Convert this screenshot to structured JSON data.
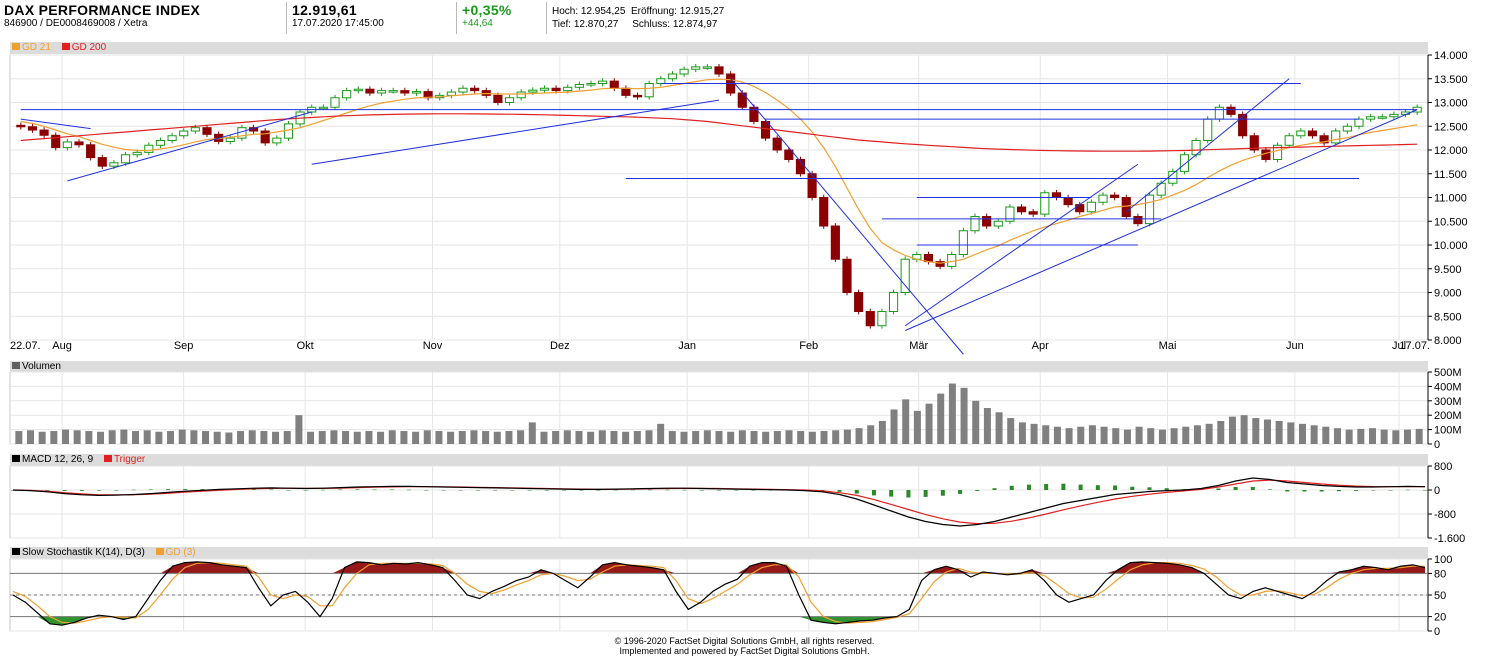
{
  "header": {
    "title": "DAX PERFORMANCE INDEX",
    "subtitle": "846900 / DE0008469008 / Xetra",
    "price": "12.919,61",
    "datetime": "17.07.2020 17:45:00",
    "change_pct": "+0,35%",
    "change_abs": "+44,64",
    "high_label": "Hoch:",
    "high": "12.954,25",
    "open_label": "Eröffnung:",
    "open": "12.915,27",
    "low_label": "Tief:",
    "low": "12.870,27",
    "close_label": "Schluss:",
    "close": "12.874,97"
  },
  "colors": {
    "up": "#1a9a1a",
    "down": "#8b0000",
    "gd21": "#f0a030",
    "gd200": "#e02020",
    "trend": "#2030e0",
    "volume": "#808080",
    "macd": "#000000",
    "trigger": "#e02020",
    "hist": "#2a8a2a"
  },
  "legend": {
    "price": [
      {
        "label": "GD 21",
        "color": "#f0a030"
      },
      {
        "label": "GD 200",
        "color": "#e02020"
      }
    ],
    "volume": [
      {
        "label": "Volumen",
        "color": "#606060"
      }
    ],
    "macd": [
      {
        "label": "MACD 12, 26, 9",
        "color": "#000000"
      },
      {
        "label": "Trigger",
        "color": "#e02020"
      }
    ],
    "stoch": [
      {
        "label": "Slow Stochastik K(14), D(3)",
        "color": "#000000"
      },
      {
        "label": "GD (3)",
        "color": "#f0a030"
      }
    ]
  },
  "footer": {
    "line1": "© 1996-2020 FactSet Digital Solutions GmbH, all rights reserved.",
    "line2": "Implemented and powered by FactSet Digital Solutions GmbH."
  },
  "chart_data": [
    {
      "type": "line",
      "name": "price",
      "x_labels": [
        "22.07.",
        "Aug",
        "Sep",
        "Okt",
        "Nov",
        "Dez",
        "Jan",
        "Feb",
        "Mär",
        "Apr",
        "Mai",
        "Jun",
        "Jul",
        "17.07."
      ],
      "x_positions": [
        0,
        9,
        30,
        51,
        73,
        95,
        117,
        138,
        157,
        178,
        200,
        222,
        240,
        244
      ],
      "ylim": [
        8000,
        14000
      ],
      "yticks": [
        "14.000",
        "13.500",
        "13.000",
        "12.500",
        "12.000",
        "11.500",
        "11.000",
        "10.500",
        "10.000",
        "9.500",
        "9.000",
        "8.500",
        "8.000"
      ],
      "ytick_values": [
        14000,
        13500,
        13000,
        12500,
        12000,
        11500,
        11000,
        10500,
        10000,
        9500,
        9000,
        8500,
        8000
      ],
      "close": [
        12490,
        12420,
        12310,
        12050,
        12170,
        12110,
        11840,
        11660,
        11730,
        11900,
        11950,
        12100,
        12200,
        12300,
        12400,
        12470,
        12330,
        12180,
        12250,
        12470,
        12400,
        12150,
        12250,
        12550,
        12800,
        12900,
        12900,
        13100,
        13250,
        13280,
        13200,
        13250,
        13250,
        13200,
        13230,
        13100,
        13150,
        13220,
        13300,
        13250,
        13150,
        13000,
        13100,
        13220,
        13260,
        13300,
        13250,
        13320,
        13380,
        13400,
        13450,
        13300,
        13150,
        13120,
        13400,
        13500,
        13600,
        13700,
        13750,
        13750,
        13600,
        13200,
        12900,
        12600,
        12250,
        12000,
        11800,
        11500,
        11000,
        10400,
        9700,
        9000,
        8600,
        8300,
        8600,
        9000,
        9700,
        9800,
        9650,
        9550,
        9800,
        10300,
        10600,
        10400,
        10500,
        10800,
        10700,
        10650,
        11100,
        11000,
        10850,
        10700,
        10900,
        11050,
        11000,
        10600,
        10450,
        11050,
        11300,
        11550,
        11900,
        12200,
        12650,
        12900,
        12750,
        12300,
        12000,
        11800,
        12100,
        12300,
        12400,
        12300,
        12150,
        12400,
        12500,
        12650,
        12700,
        12700,
        12750,
        12800,
        12900
      ],
      "gd21": [
        12600,
        12560,
        12500,
        12420,
        12340,
        12280,
        12200,
        12120,
        12060,
        12010,
        11990,
        11990,
        12020,
        12060,
        12110,
        12170,
        12220,
        12240,
        12270,
        12300,
        12330,
        12340,
        12380,
        12420,
        12470,
        12540,
        12620,
        12700,
        12780,
        12860,
        12930,
        12990,
        13030,
        13070,
        13100,
        13110,
        13120,
        13140,
        13160,
        13180,
        13190,
        13180,
        13180,
        13180,
        13190,
        13200,
        13210,
        13220,
        13240,
        13260,
        13290,
        13300,
        13300,
        13290,
        13300,
        13320,
        13360,
        13400,
        13440,
        13480,
        13490,
        13480,
        13430,
        13340,
        13210,
        13050,
        12870,
        12650,
        12380,
        12050,
        11650,
        11200,
        10750,
        10350,
        10050,
        9900,
        9780,
        9700,
        9650,
        9620,
        9650,
        9700,
        9800,
        9900,
        9980,
        10100,
        10200,
        10300,
        10380,
        10450,
        10520,
        10600,
        10660,
        10730,
        10800,
        10820,
        10850,
        10900,
        10960,
        11050,
        11150,
        11270,
        11420,
        11560,
        11680,
        11780,
        11860,
        11930,
        11990,
        12050,
        12100,
        12140,
        12170,
        12220,
        12260,
        12320,
        12370,
        12410,
        12450,
        12490,
        12530
      ],
      "gd200": [
        12200,
        12220,
        12240,
        12260,
        12280,
        12300,
        12320,
        12340,
        12360,
        12380,
        12400,
        12420,
        12440,
        12460,
        12480,
        12500,
        12520,
        12540,
        12560,
        12580,
        12600,
        12620,
        12640,
        12655,
        12670,
        12685,
        12700,
        12712,
        12722,
        12730,
        12738,
        12745,
        12750,
        12755,
        12758,
        12760,
        12762,
        12762,
        12762,
        12760,
        12758,
        12756,
        12754,
        12750,
        12746,
        12740,
        12734,
        12728,
        12722,
        12716,
        12710,
        12704,
        12698,
        12690,
        12680,
        12670,
        12660,
        12640,
        12620,
        12600,
        12570,
        12540,
        12510,
        12480,
        12450,
        12420,
        12390,
        12360,
        12330,
        12300,
        12270,
        12240,
        12210,
        12190,
        12170,
        12150,
        12130,
        12115,
        12100,
        12085,
        12070,
        12055,
        12040,
        12028,
        12018,
        12010,
        12002,
        11996,
        11990,
        11985,
        11980,
        11978,
        11976,
        11975,
        11974,
        11974,
        11975,
        11977,
        11980,
        11985,
        11990,
        11998,
        12006,
        12014,
        12022,
        12030,
        12037,
        12044,
        12050,
        12056,
        12062,
        12068,
        12074,
        12080,
        12086,
        12092,
        12098,
        12104,
        12110,
        12116,
        12122
      ]
    },
    {
      "type": "bar",
      "name": "Volumen",
      "ylim": [
        0,
        500
      ],
      "yticks": [
        "500M",
        "400M",
        "300M",
        "200M",
        "100M",
        "0"
      ],
      "ytick_values": [
        500,
        400,
        300,
        200,
        100,
        0
      ],
      "values": [
        90,
        95,
        85,
        90,
        100,
        95,
        90,
        85,
        95,
        100,
        90,
        95,
        85,
        90,
        100,
        95,
        90,
        85,
        80,
        90,
        95,
        90,
        85,
        90,
        200,
        85,
        90,
        95,
        90,
        85,
        90,
        85,
        95,
        90,
        85,
        95,
        90,
        85,
        90,
        95,
        90,
        85,
        90,
        95,
        150,
        85,
        90,
        95,
        90,
        85,
        95,
        90,
        85,
        90,
        95,
        140,
        90,
        85,
        90,
        95,
        90,
        85,
        95,
        90,
        85,
        90,
        95,
        90,
        85,
        90,
        95,
        100,
        110,
        130,
        160,
        240,
        310,
        230,
        280,
        350,
        420,
        390,
        300,
        250,
        220,
        180,
        150,
        140,
        130,
        120,
        110,
        120,
        130,
        120,
        110,
        100,
        120,
        110,
        100,
        110,
        120,
        130,
        140,
        160,
        190,
        200,
        180,
        170,
        160,
        150,
        140,
        130,
        120,
        110,
        100,
        105,
        110,
        100,
        95,
        100,
        105
      ]
    },
    {
      "type": "line",
      "name": "MACD 12, 26, 9",
      "ylim": [
        -1600,
        800
      ],
      "yticks": [
        "800",
        "0",
        "-800",
        "-1.600"
      ],
      "ytick_values": [
        800,
        0,
        -800,
        -1600
      ],
      "macd": [
        0,
        -20,
        -60,
        -120,
        -160,
        -180,
        -170,
        -150,
        -120,
        -80,
        -40,
        -10,
        20,
        40,
        60,
        70,
        60,
        50,
        60,
        80,
        100,
        110,
        120,
        120,
        110,
        100,
        90,
        80,
        70,
        60,
        50,
        40,
        30,
        20,
        20,
        30,
        40,
        50,
        60,
        60,
        50,
        40,
        30,
        20,
        10,
        0,
        -20,
        -60,
        -150,
        -300,
        -500,
        -700,
        -900,
        -1050,
        -1150,
        -1200,
        -1150,
        -1050,
        -900,
        -750,
        -600,
        -450,
        -350,
        -250,
        -150,
        -100,
        -50,
        -20,
        0,
        50,
        150,
        300,
        400,
        350,
        250,
        200,
        150,
        120,
        100,
        100,
        110,
        120,
        110
      ],
      "trigger": [
        0,
        -10,
        -40,
        -90,
        -130,
        -160,
        -165,
        -160,
        -140,
        -110,
        -70,
        -40,
        -10,
        20,
        40,
        55,
        60,
        55,
        55,
        65,
        80,
        95,
        105,
        110,
        110,
        105,
        100,
        90,
        80,
        70,
        60,
        50,
        40,
        30,
        25,
        25,
        30,
        40,
        50,
        55,
        55,
        50,
        40,
        30,
        20,
        10,
        0,
        -30,
        -90,
        -180,
        -320,
        -480,
        -650,
        -820,
        -960,
        -1070,
        -1120,
        -1110,
        -1040,
        -930,
        -800,
        -660,
        -530,
        -410,
        -300,
        -210,
        -140,
        -80,
        -30,
        20,
        100,
        200,
        300,
        330,
        300,
        250,
        200,
        160,
        130,
        115,
        110,
        110,
        110
      ],
      "histogram": [
        0,
        -10,
        -20,
        -30,
        -30,
        -20,
        -5,
        10,
        20,
        30,
        30,
        30,
        30,
        20,
        20,
        15,
        0,
        -5,
        5,
        15,
        20,
        15,
        15,
        10,
        0,
        -5,
        -10,
        -10,
        -10,
        -10,
        -10,
        -10,
        -10,
        -10,
        -5,
        5,
        10,
        10,
        10,
        5,
        -5,
        -10,
        -10,
        -10,
        -10,
        -10,
        -20,
        -30,
        -60,
        -120,
        -180,
        -220,
        -250,
        -230,
        -190,
        -130,
        -30,
        60,
        140,
        180,
        200,
        210,
        180,
        160,
        150,
        110,
        90,
        60,
        30,
        30,
        50,
        100,
        100,
        20,
        -50,
        -50,
        -50,
        -40,
        -30,
        -15,
        0,
        10,
        0
      ]
    },
    {
      "type": "line",
      "name": "Slow Stochastik K(14), D(3)",
      "ylim": [
        0,
        100
      ],
      "yticks": [
        "100",
        "80",
        "50",
        "20",
        "0"
      ],
      "ytick_values": [
        100,
        80,
        50,
        20,
        0
      ],
      "k": [
        50,
        40,
        25,
        10,
        8,
        12,
        18,
        22,
        20,
        16,
        20,
        45,
        70,
        90,
        95,
        96,
        95,
        92,
        90,
        88,
        60,
        35,
        50,
        55,
        40,
        20,
        45,
        88,
        96,
        95,
        92,
        94,
        93,
        95,
        92,
        88,
        70,
        50,
        45,
        55,
        62,
        70,
        75,
        85,
        80,
        70,
        60,
        75,
        92,
        95,
        92,
        90,
        88,
        85,
        55,
        30,
        40,
        55,
        65,
        72,
        90,
        95,
        95,
        90,
        50,
        15,
        12,
        10,
        12,
        14,
        15,
        18,
        20,
        30,
        70,
        85,
        90,
        85,
        75,
        82,
        80,
        78,
        80,
        85,
        70,
        50,
        40,
        45,
        50,
        70,
        85,
        95,
        96,
        95,
        94,
        92,
        88,
        80,
        65,
        50,
        45,
        55,
        60,
        55,
        50,
        45,
        55,
        70,
        82,
        85,
        90,
        88,
        85,
        90,
        92,
        88
      ],
      "d": [
        55,
        48,
        35,
        20,
        12,
        11,
        14,
        18,
        20,
        19,
        18,
        30,
        50,
        72,
        88,
        94,
        95,
        94,
        92,
        90,
        75,
        50,
        45,
        50,
        48,
        35,
        35,
        60,
        80,
        92,
        94,
        94,
        94,
        94,
        93,
        91,
        80,
        65,
        55,
        52,
        57,
        64,
        70,
        78,
        80,
        76,
        70,
        72,
        82,
        90,
        92,
        91,
        90,
        88,
        70,
        45,
        38,
        45,
        55,
        65,
        78,
        88,
        92,
        92,
        75,
        40,
        20,
        13,
        11,
        12,
        13,
        16,
        19,
        24,
        45,
        68,
        82,
        87,
        82,
        80,
        80,
        79,
        79,
        81,
        77,
        65,
        52,
        46,
        47,
        58,
        72,
        85,
        92,
        95,
        95,
        94,
        91,
        86,
        75,
        60,
        50,
        50,
        55,
        56,
        53,
        49,
        51,
        60,
        72,
        80,
        85,
        87,
        87,
        88,
        90,
        90
      ]
    }
  ]
}
